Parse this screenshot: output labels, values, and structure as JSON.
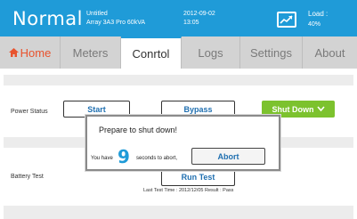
{
  "header": {
    "mode": "Normal",
    "file_name": "Untitled",
    "model": "Array 3A3 Pro 60kVA",
    "date": "2012-09-02",
    "time": "13:05",
    "load_label": "Load :",
    "load_value": "40%",
    "load_icon": "load-meter-icon"
  },
  "tabs": [
    {
      "label": "Home",
      "icon": "house-icon"
    },
    {
      "label": "Meters"
    },
    {
      "label": "Conrtol"
    },
    {
      "label": "Logs"
    },
    {
      "label": "Settings"
    },
    {
      "label": "About"
    }
  ],
  "active_tab": "Conrtol",
  "control": {
    "power_status_label": "Power Status",
    "start_button": "Start",
    "bypass_button": "Bypass",
    "shutdown_button": "Shut Down",
    "battery_test_label": "Battery Test",
    "run_test_button": "Run Test",
    "last_test": "Last Test Time : 2012/12/05    Result : Pass"
  },
  "dialog": {
    "title": "Prepare to shut down!",
    "text_before": "You have",
    "countdown": "9",
    "text_after": "seconds to abort,",
    "abort_button": "Abort"
  },
  "colors": {
    "accent": "#1f9bd8",
    "shutdown": "#7cc22e",
    "home_tab": "#e8532e"
  }
}
